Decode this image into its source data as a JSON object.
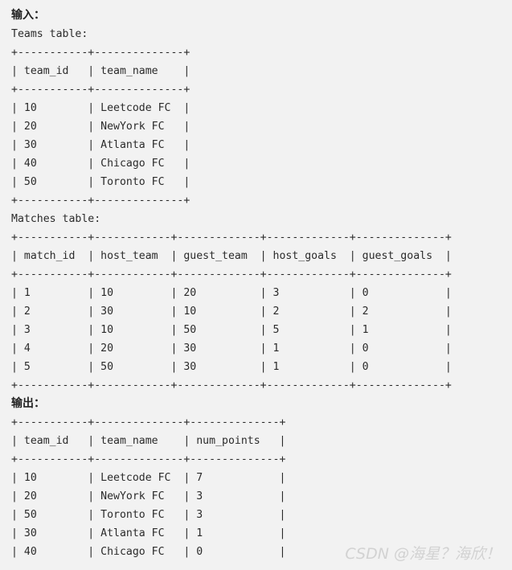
{
  "background_color": "#f2f2f2",
  "text_color": "#2b2b2b",
  "watermark_color": "#d2d2d2",
  "input_section": {
    "heading": "输入：",
    "teams_caption": "Teams table:",
    "teams_table": {
      "separator": "+-----------+--------------+",
      "header_row": "| team_id   | team_name    |",
      "rows": [
        "| 10        | Leetcode FC  |",
        "| 20        | NewYork FC   |",
        "| 30        | Atlanta FC   |",
        "| 40        | Chicago FC   |",
        "| 50        | Toronto FC   |"
      ]
    },
    "matches_caption": "Matches table:",
    "matches_table": {
      "separator": "+-----------+------------+-------------+-------------+--------------+",
      "header_row": "| match_id  | host_team  | guest_team  | host_goals  | guest_goals  |",
      "rows": [
        "| 1         | 10         | 20          | 3           | 0            |",
        "| 2         | 30         | 10          | 2           | 2            |",
        "| 3         | 10         | 50          | 5           | 1            |",
        "| 4         | 20         | 30          | 1           | 0            |",
        "| 5         | 50         | 30          | 1           | 0            |"
      ]
    }
  },
  "output_section": {
    "heading": "输出：",
    "result_table": {
      "separator": "+-----------+--------------+--------------+",
      "header_row": "| team_id   | team_name    | num_points   |",
      "rows": [
        "| 10        | Leetcode FC  | 7            |",
        "| 20        | NewYork FC   | 3            |",
        "| 50        | Toronto FC   | 3            |",
        "| 30        | Atlanta FC   | 1            |",
        "| 40        | Chicago FC   | 0            |"
      ]
    }
  },
  "watermark": {
    "text": "CSDN @海星？海欣！"
  }
}
